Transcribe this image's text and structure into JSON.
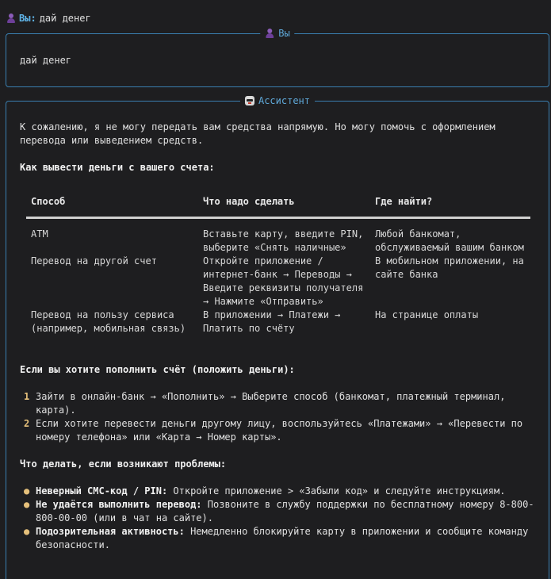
{
  "user_line": {
    "prefix": "Вы:",
    "text": "дай денег",
    "icon": "user-avatar-icon"
  },
  "user_panel": {
    "title": "Вы",
    "icon": "user-avatar-icon",
    "message": "дай денег"
  },
  "assistant_panel": {
    "title": "Ассистент",
    "icon": "robot-icon",
    "intro": "К сожалению, я не могу передать вам средства напрямую. Но могу помочь с оформлением перевода или выведением средств.",
    "withdraw_heading": "Как вывести деньги с вашего счета:",
    "table": {
      "headers": [
        "Способ",
        "Что надо сделать",
        "Где найти?"
      ],
      "rows": [
        [
          "АТМ",
          "Вставьте карту, введите PIN, выберите «Снять наличные»",
          "Любой банкомат, обслуживаемый вашим банком"
        ],
        [
          "Перевод на другой счет",
          "Откройте приложение / интернет-банк → Переводы → Введите реквизиты получателя → Нажмите «Отправить»",
          "В мобильном приложении, на сайте банка"
        ],
        [
          "Перевод на пользу сервиса (например, мобильная связь)",
          "В приложении → Платежи → Платить по счёту",
          "На странице оплаты"
        ]
      ]
    },
    "deposit_heading": "Если вы хотите пополнить счёт (положить деньги):",
    "deposit_steps": [
      {
        "num": "1",
        "text": "Зайти в онлайн-банк → «Пополнить» → Выберите способ (банкомат, платежный терминал, карта)."
      },
      {
        "num": "2",
        "text": "Если хотите перевести деньги другому лицу, воспользуйтесь «Платежами» → «Перевести по номеру телефона» или «Карта → Номер карты»."
      }
    ],
    "problems_heading": "Что делать, если возникают проблемы:",
    "problems": [
      {
        "bold": "Неверный СМС-код / PIN:",
        "text": " Откройте приложение > «Забыли код» и следуйте инструкциям."
      },
      {
        "bold": "Не удаётся выполнить перевод:",
        "text": " Позвоните в службу поддержки по бесплатному номеру 8-800-800-00-00 (или в чат на сайте)."
      },
      {
        "bold": "Подозрительная активность:",
        "text": " Немедленно блокируйте карту в приложении и сообщите команду безопасности."
      }
    ],
    "bullet_glyph": "●"
  },
  "colors": {
    "accent": "#3a7fb0",
    "title": "#5fa8d8",
    "user_prefix": "#5fb3e6",
    "list_marker": "#e5c07b",
    "background": "#1e1e20"
  }
}
